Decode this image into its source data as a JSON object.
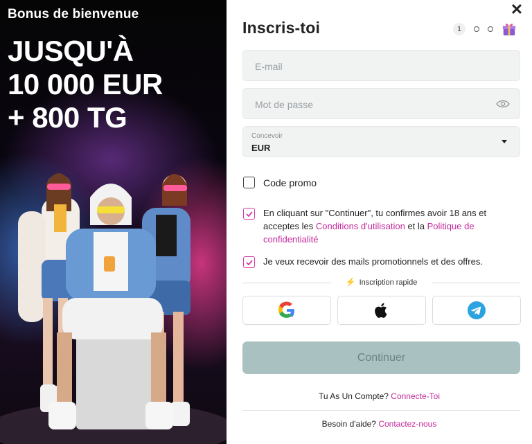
{
  "promo": {
    "kicker": "Bonus de bienvenue",
    "headline_lines": [
      "JUSQU'À",
      "10 000 EUR",
      "+ 800 TG"
    ]
  },
  "form": {
    "title": "Inscris-toi",
    "close_icon": "close-icon",
    "steps": {
      "current": "1"
    },
    "email": {
      "placeholder": "E-mail",
      "value": ""
    },
    "password": {
      "placeholder": "Mot de passe",
      "value": ""
    },
    "currency": {
      "label": "Concevoir",
      "value": "EUR"
    },
    "promo_code": {
      "label": "Code promo",
      "checked": false
    },
    "terms": {
      "checked": true,
      "text_before": "En cliquant sur \"Continuer\", tu confirmes avoir 18 ans et acceptes les ",
      "link_terms": "Conditions d'utilisation",
      "text_middle": " et la ",
      "link_privacy": "Politique de confidentialité"
    },
    "marketing": {
      "checked": true,
      "label": "Je veux recevoir des mails promotionnels et des offres."
    },
    "quick_signup": "Inscription rapide",
    "social": [
      "google-icon",
      "apple-icon",
      "telegram-icon"
    ],
    "continue_label": "Continuer",
    "account": {
      "text": "Tu As Un Compte? ",
      "link": "Connecte-Toi"
    },
    "help": {
      "text": "Besoin d'aide? ",
      "link": "Contactez-nous"
    }
  },
  "colors": {
    "accent_pink": "#c32a9b",
    "continue_bg": "#a9c1c0",
    "telegram_blue": "#2aa3e0",
    "bolt_orange": "#f08a24"
  }
}
